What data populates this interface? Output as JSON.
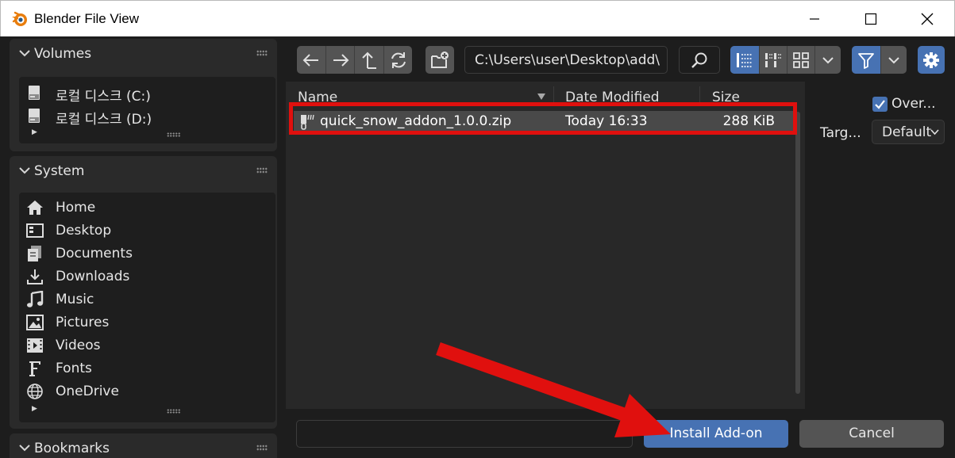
{
  "window": {
    "title": "Blender File View",
    "controls": [
      "minimize-icon",
      "maximize-icon",
      "close-icon"
    ]
  },
  "sidebar": {
    "volumes": {
      "title": "Volumes",
      "items": [
        {
          "label": "로컬 디스크 (C:)",
          "icon": "drive-icon"
        },
        {
          "label": "로컬 디스크 (D:)",
          "icon": "drive-icon"
        }
      ]
    },
    "system": {
      "title": "System",
      "items": [
        {
          "label": "Home",
          "icon": "home-icon"
        },
        {
          "label": "Desktop",
          "icon": "desktop-icon"
        },
        {
          "label": "Documents",
          "icon": "documents-icon"
        },
        {
          "label": "Downloads",
          "icon": "downloads-icon"
        },
        {
          "label": "Music",
          "icon": "music-icon"
        },
        {
          "label": "Pictures",
          "icon": "pictures-icon"
        },
        {
          "label": "Videos",
          "icon": "videos-icon"
        },
        {
          "label": "Fonts",
          "icon": "fonts-icon"
        },
        {
          "label": "OneDrive",
          "icon": "onedrive-icon"
        }
      ]
    },
    "bookmarks": {
      "title": "Bookmarks"
    }
  },
  "toolbar": {
    "path": "C:\\Users\\user\\Desktop\\add\\",
    "nav_icons": [
      "back-icon",
      "forward-icon",
      "parent-directory-icon",
      "refresh-icon"
    ],
    "view_icons": [
      "vertical-list-icon",
      "horizontal-list-icon",
      "thumbnails-icon"
    ]
  },
  "file_list": {
    "columns": {
      "name": "Name",
      "date": "Date Modified",
      "size": "Size"
    },
    "rows": [
      {
        "name": "quick_snow_addon_1.0.0.zip",
        "date": "Today 16:33",
        "size": "288 KiB"
      }
    ]
  },
  "options": {
    "overwrite_label": "Over...",
    "overwrite_checked": true,
    "target_label": "Targ...",
    "target_value": "Default"
  },
  "bottom": {
    "filename_value": "",
    "install_label": "Install Add-on",
    "cancel_label": "Cancel"
  },
  "colors": {
    "accent": "#4772b3",
    "annotation": "#e0100e",
    "background": "#1d1d1d"
  }
}
